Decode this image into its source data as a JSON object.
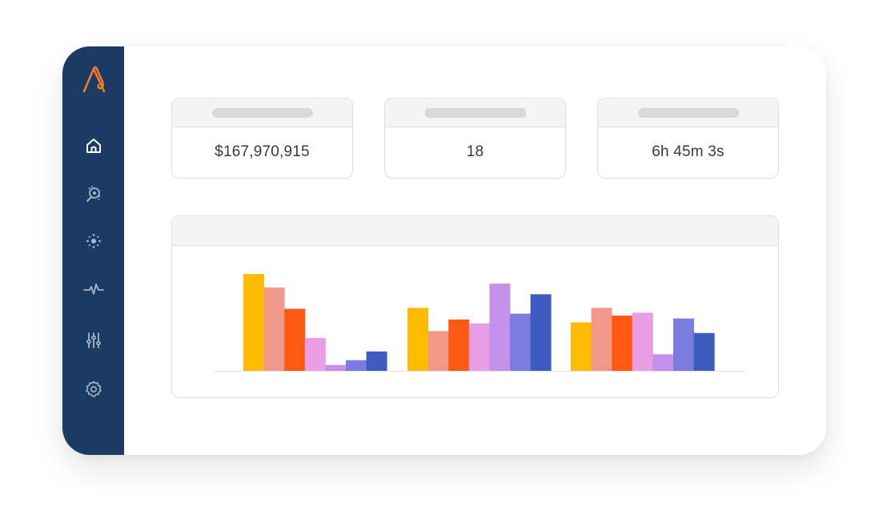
{
  "colors": {
    "sidebar_bg": "#1b3a64",
    "logo": "#f07c2a",
    "nav_icon": "#ffffff",
    "nav_icon_active": "#ffffff"
  },
  "sidebar": {
    "logo": "logo-icon",
    "items": [
      {
        "icon": "home-icon",
        "active": true
      },
      {
        "icon": "search-analysis-icon"
      },
      {
        "icon": "nodes-icon"
      },
      {
        "icon": "activity-icon"
      },
      {
        "icon": "sliders-icon"
      },
      {
        "icon": "settings-icon"
      }
    ]
  },
  "stats": [
    {
      "value": "$167,970,915"
    },
    {
      "value": "18"
    },
    {
      "value": "6h 45m 3s"
    }
  ],
  "chart_data": {
    "type": "bar",
    "title": "",
    "xlabel": "",
    "ylabel": "",
    "grid": false,
    "categories": [
      "",
      "",
      ""
    ],
    "series": [
      {
        "color": "#ffbb00",
        "values": [
          100,
          65,
          50
        ]
      },
      {
        "color": "#f0988a",
        "values": [
          86,
          41,
          65
        ]
      },
      {
        "color": "#ff5a14",
        "values": [
          64,
          53,
          57
        ]
      },
      {
        "color": "#e79ee4",
        "values": [
          34,
          49,
          60
        ]
      },
      {
        "color": "#c390ea",
        "values": [
          6,
          90,
          17
        ]
      },
      {
        "color": "#7a7cdf",
        "values": [
          11,
          59,
          54
        ]
      },
      {
        "color": "#3e5bbf",
        "values": [
          20,
          79,
          39
        ]
      }
    ],
    "ylim": [
      0,
      100
    ]
  }
}
